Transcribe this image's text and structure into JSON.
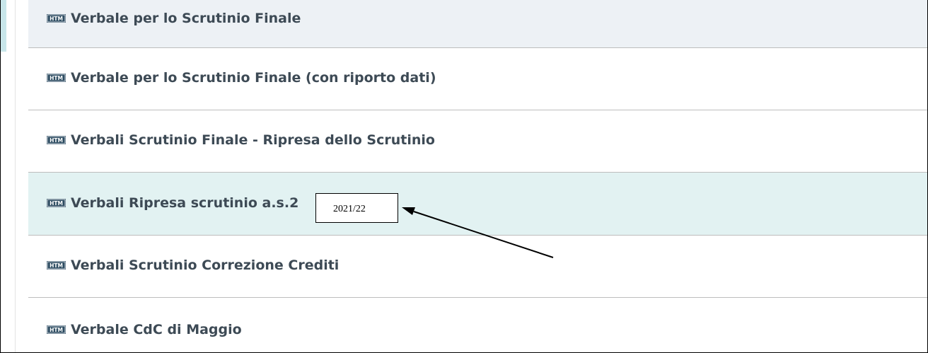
{
  "icon_label": "HTM",
  "items": [
    {
      "label": "Verbale per lo Scrutinio Finale",
      "icon": "htm-file-icon"
    },
    {
      "label": "Verbale per lo Scrutinio Finale (con riporto dati)",
      "icon": "htm-file-icon"
    },
    {
      "label": "Verbali Scrutinio Finale - Ripresa dello Scrutinio",
      "icon": "htm-file-icon"
    },
    {
      "label": "Verbali Ripresa scrutinio a.s.2",
      "icon": "htm-file-icon"
    },
    {
      "label": "Verbali Scrutinio Correzione Crediti",
      "icon": "htm-file-icon"
    },
    {
      "label": "Verbale CdC di Maggio",
      "icon": "htm-file-icon"
    }
  ],
  "callout": {
    "text": "2021/22"
  },
  "colors": {
    "accent": "#c8e6ea",
    "row_highlight": "#e2f2f2",
    "row_first": "#edf1f5",
    "icon_bg": "#2f4e63",
    "text": "#3d4a55"
  }
}
